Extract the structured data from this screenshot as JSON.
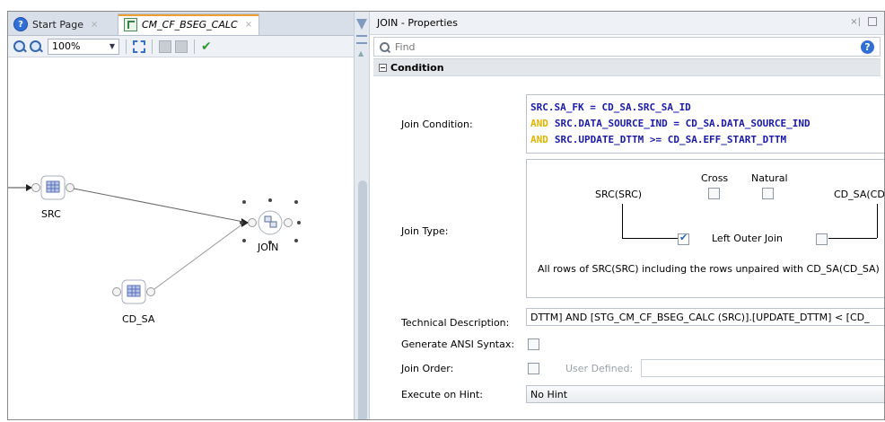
{
  "editor": {
    "tabs": [
      {
        "label": "Start Page",
        "close": "×"
      },
      {
        "label": "CM_CF_BSEG_CALC",
        "close": "×"
      }
    ],
    "toolbar": {
      "zoom_value": "100%",
      "icons": [
        "zoom-in-icon",
        "zoom-out-icon",
        "fit-to-window-icon",
        "layout-icon",
        "disabled-icon",
        "validate-check-icon"
      ]
    },
    "nodes": {
      "src": "SRC",
      "join": "JOIN",
      "cd_sa": "CD_SA"
    }
  },
  "properties": {
    "title": "JOIN - Properties",
    "find_placeholder": "Find",
    "help_icon": "?",
    "section": "Condition",
    "join_condition": {
      "label": "Join Condition:",
      "lines": [
        {
          "keyword": "",
          "text": "SRC.SA_FK = CD_SA.SRC_SA_ID"
        },
        {
          "keyword": "AND",
          "text": "SRC.DATA_SOURCE_IND = CD_SA.DATA_SOURCE_IND"
        },
        {
          "keyword": "AND",
          "text": "SRC.UPDATE_DTTM >= CD_SA.EFF_START_DTTM"
        }
      ]
    },
    "join_type": {
      "label": "Join Type:",
      "cross_label": "Cross",
      "cross_checked": false,
      "natural_label": "Natural",
      "natural_checked": false,
      "left_source": "SRC(SRC)",
      "right_source": "CD_SA(CD",
      "left_outer_checked": true,
      "left_outer_label": "Left Outer Join",
      "right_outer_checked": false,
      "description": "All rows of SRC(SRC) including the rows unpaired with CD_SA(CD_SA)"
    },
    "technical_description": {
      "label": "Technical Description:",
      "value": "DTTM]  AND [STG_CM_CF_BSEG_CALC (SRC)].[UPDATE_DTTM] < [CD_"
    },
    "generate_ansi": {
      "label": "Generate ANSI Syntax:",
      "checked": false
    },
    "join_order": {
      "label": "Join Order:",
      "checked": false,
      "user_defined_label": "User Defined:",
      "user_defined_value": ""
    },
    "execute_on_hint": {
      "label": "Execute on Hint:",
      "value": "No Hint"
    }
  },
  "colors": {
    "code_text": "#1a1aa8",
    "code_keyword": "#e0b400",
    "active_tab_accent": "#f0a030",
    "check_green": "#2f9a36"
  }
}
